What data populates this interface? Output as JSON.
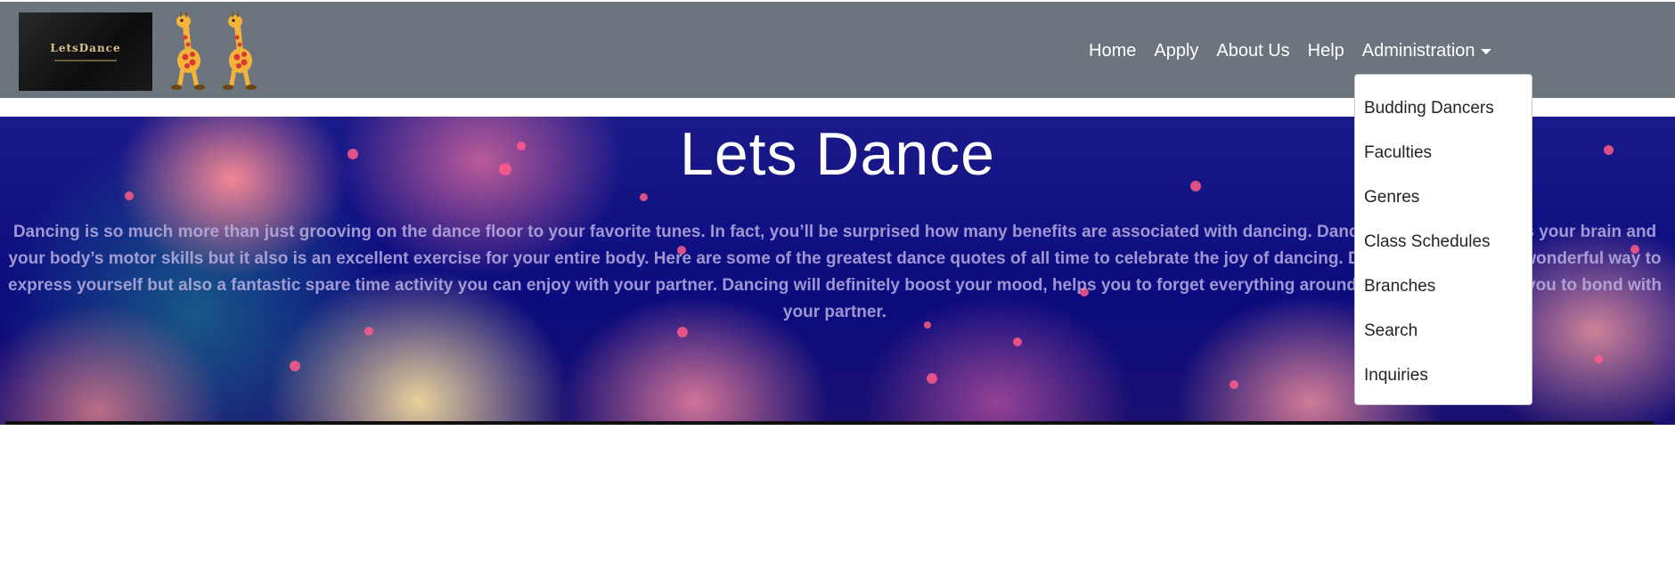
{
  "logo": {
    "text": "LetsDance"
  },
  "nav": {
    "links": [
      "Home",
      "Apply",
      "About Us",
      "Help"
    ],
    "admin_label": "Administration"
  },
  "hero": {
    "title": "Lets Dance",
    "description": "Dancing is so much more than just grooving on the dance floor to your favorite tunes. In fact, you’ll be surprised how many benefits are associated with dancing. Dancing not only improves your brain and your body’s motor skills but it also is an excellent exercise for your entire body. Here are some of the greatest dance quotes of all time to celebrate the joy of dancing. Dancing is not only a wonderful way to express yourself but also a fantastic spare time activity you can enjoy with your partner. Dancing will definitely boost your mood, helps you to forget everything around you and also allows you to bond with your partner."
  },
  "dropdown": {
    "items": [
      "Budding Dancers",
      "Faculties",
      "Genres",
      "Class Schedules",
      "Branches",
      "Search",
      "Inquiries"
    ]
  },
  "colors": {
    "navbar": "#6c757d",
    "hero_base": "#0b0b7e",
    "dropdown_bg": "#ffffff"
  },
  "icons": [
    "giraffe-icon",
    "caret-down-icon"
  ]
}
